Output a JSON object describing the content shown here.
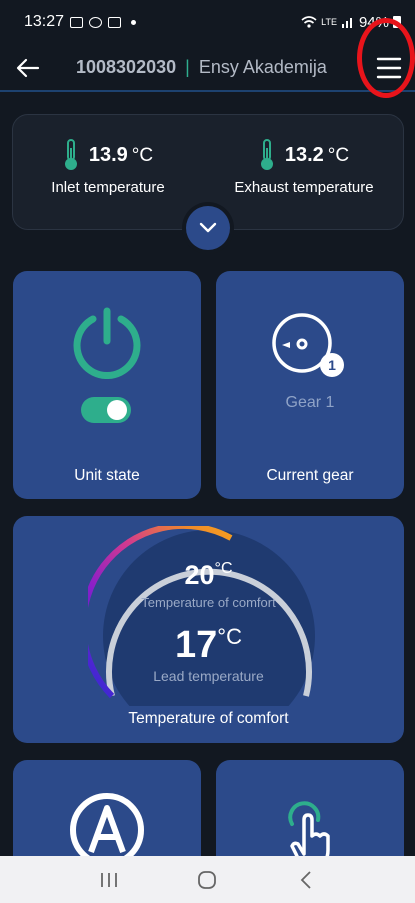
{
  "status_bar": {
    "time": "13:27",
    "battery": "94%",
    "network": "LTE"
  },
  "header": {
    "device_id": "1008302030",
    "separator": "|",
    "location": "Ensy Akademija",
    "back_icon": "arrow-left-icon",
    "menu_icon": "hamburger-menu-icon",
    "highlight_color": "#e8141b"
  },
  "temperatures": {
    "inlet": {
      "value": "13.9",
      "unit": "°C",
      "label": "Inlet temperature"
    },
    "exhaust": {
      "value": "13.2",
      "unit": "°C",
      "label": "Exhaust temperature"
    }
  },
  "tiles": {
    "unit_state": {
      "label": "Unit state",
      "on": true
    },
    "current_gear": {
      "label": "Current gear",
      "value": "Gear 1",
      "badge": "1"
    },
    "comfort": {
      "label": "Temperature of comfort",
      "comfort_value": "20",
      "comfort_unit": "°C",
      "comfort_label": "Temperature of comfort",
      "lead_value": "17",
      "lead_unit": "°C",
      "lead_label": "Lead temperature"
    },
    "auto_icon": "auto-mode-icon",
    "touch_icon": "touch-hand-icon"
  },
  "colors": {
    "accent": "#2eae8c",
    "tile": "#2c4a8a",
    "background": "#121821"
  }
}
